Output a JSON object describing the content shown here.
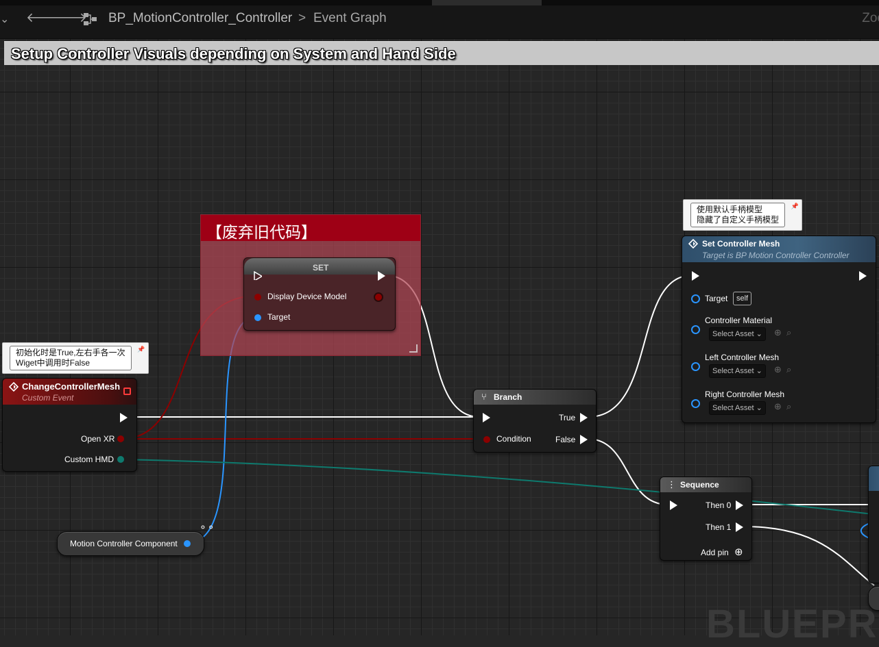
{
  "topbar": {
    "back_icon": "arrow-left-icon",
    "forward_icon": "arrow-right-icon",
    "graph_icon": "blueprint-graph-icon",
    "breadcrumb_root": "BP_MotionController_Controller",
    "breadcrumb_separator": ">",
    "breadcrumb_current": "Event Graph",
    "zoom_label": "Zoo"
  },
  "comment": {
    "title": "Setup Controller Visuals depending on System and Hand Side"
  },
  "group": {
    "title": "【废弃旧代码】"
  },
  "notes": {
    "change_controller": [
      "初始化时是True,左右手各一次",
      "Wiget中调用时False"
    ],
    "set_controller_mesh": [
      "使用默认手柄模型",
      "隐藏了自定义手柄模型"
    ]
  },
  "nodes": {
    "set": {
      "title": "SET",
      "display_device_model": "Display Device Model",
      "target": "Target"
    },
    "change_controller_mesh": {
      "title": "ChangeControllerMesh",
      "subtitle": "Custom Event",
      "open_xr": "Open XR",
      "custom_hmd": "Custom HMD"
    },
    "branch": {
      "title": "Branch",
      "condition": "Condition",
      "true_label": "True",
      "false_label": "False"
    },
    "set_controller_mesh": {
      "title": "Set Controller Mesh",
      "subtitle": "Target is BP Motion Controller Controller",
      "target": "Target",
      "target_value": "self",
      "controller_material": "Controller Material",
      "left_controller_mesh": "Left Controller Mesh",
      "right_controller_mesh": "Right Controller Mesh",
      "select_asset": "Select Asset"
    },
    "sequence": {
      "title": "Sequence",
      "then0": "Then 0",
      "then1": "Then 1",
      "add_pin": "Add pin"
    },
    "motion_controller": {
      "label": "Motion Controller Component"
    }
  },
  "watermark": "BLUEPRIN",
  "colors": {
    "exec": "#ffffff",
    "bool_pin": "#8c0000",
    "object_pin": "#2a95ff",
    "struct_pin": "#0e7a6e",
    "event_header": "#7a0f0f",
    "function_header": "#2d4a63",
    "group_header": "#9e0015"
  }
}
